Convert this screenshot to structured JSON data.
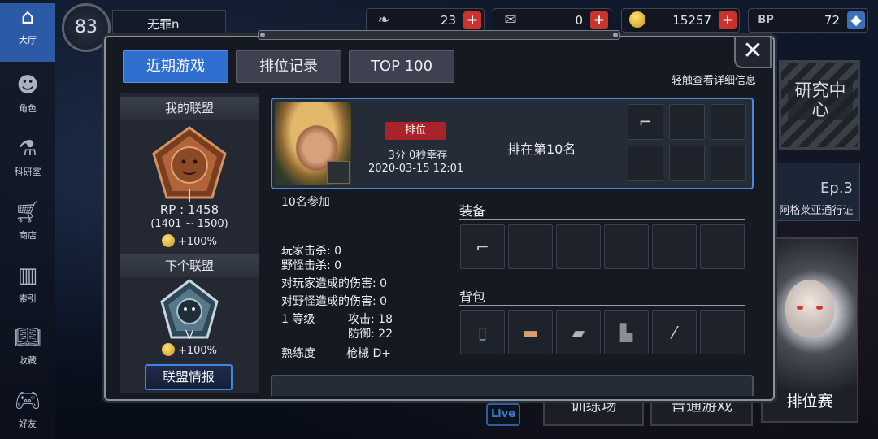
{
  "nav": {
    "items": [
      {
        "label": "大厅",
        "icon": "lobby-icon"
      },
      {
        "label": "角色",
        "icon": "character-icon"
      },
      {
        "label": "科研室",
        "icon": "lab-icon"
      },
      {
        "label": "商店",
        "icon": "shop-cart-icon"
      },
      {
        "label": "索引",
        "icon": "index-icon"
      },
      {
        "label": "收藏",
        "icon": "book-icon"
      },
      {
        "label": "好友",
        "icon": "gamepad-icon"
      }
    ]
  },
  "player": {
    "level": "83",
    "name": "无罪n"
  },
  "resources": [
    {
      "value": "23",
      "icon": "feather-icon"
    },
    {
      "value": "0",
      "icon": "ticket-icon"
    },
    {
      "value": "15257",
      "icon": "coin-icon"
    },
    {
      "value": "72",
      "icon": "bp-icon",
      "badge": "BP"
    }
  ],
  "lobby": {
    "research": "研究中心",
    "pass_ep": "Ep.3",
    "pass_name": "阿格莱亚通行证",
    "rank_mode": "排位赛",
    "training": "训练场",
    "normal": "普通游戏",
    "live": "Live"
  },
  "modal": {
    "tabs": [
      {
        "label": "近期游戏",
        "active": true
      },
      {
        "label": "排位记录",
        "active": false
      },
      {
        "label": "TOP 100",
        "active": false
      }
    ],
    "hint": "轻触查看详细信息",
    "close": "✕"
  },
  "league": {
    "my_title": "我的联盟",
    "tier": "I",
    "rp": "RP : 1458",
    "range": "(1401 ~ 1500)",
    "bonus": "+100%",
    "next_title": "下个联盟",
    "next_tier": "V",
    "next_bonus": "+100%",
    "button": "联盟情报"
  },
  "match": {
    "mode_badge": "排位",
    "survival": "3分 0秒幸存",
    "datetime": "2020-03-15 12:01",
    "placement": "排在第10名",
    "participants": "10名参加",
    "player_kills": "玩家击杀: 0",
    "monster_kills": "野怪击杀: 0",
    "player_damage": "对玩家造成的伤害: 0",
    "monster_damage": "对野怪造成的伤害: 0",
    "level": "1 等级",
    "attack": "攻击: 18",
    "defense": "防御: 22",
    "proficiency_label": "熟练度",
    "proficiency_value": "枪械 D+",
    "equipment_title": "装备",
    "bag_title": "背包",
    "equipment": [
      "pistol-icon",
      "",
      "",
      "",
      "",
      ""
    ],
    "bag": [
      "water-bottle-icon",
      "bread-icon",
      "cloth-icon",
      "boots-icon",
      "blade-icon",
      ""
    ],
    "top_slots": [
      "pistol-icon",
      "",
      "",
      "",
      "",
      ""
    ]
  },
  "colors": {
    "accent": "#2f6fcf",
    "rank_red": "#a8232a",
    "plus_red": "#c8332b"
  }
}
